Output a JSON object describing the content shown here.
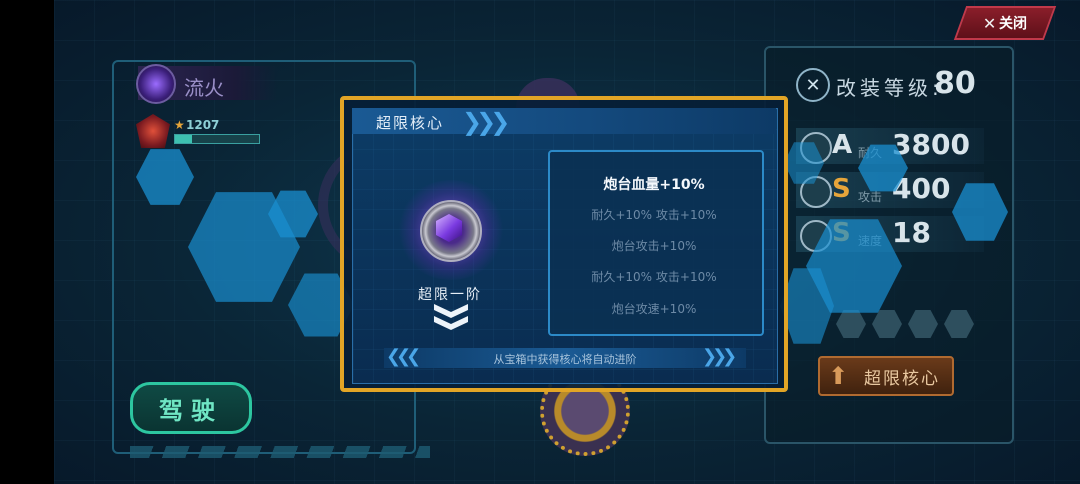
{
  "close_button": {
    "label": "关闭",
    "icon": "close-x-icon"
  },
  "pilot": {
    "name": "流火",
    "rank_value": "1207",
    "rank_progress": 0.2
  },
  "drive_button": {
    "label": "驾驶"
  },
  "modification": {
    "label": "改装等级:",
    "level": "80"
  },
  "stats": [
    {
      "grade": "A",
      "label": "耐久",
      "value": "3800",
      "grade_color": "#d8e4ea"
    },
    {
      "grade": "S",
      "label": "攻击",
      "value": "400",
      "grade_color": "#e6a53a"
    },
    {
      "grade": "S",
      "label": "速度",
      "value": "18",
      "grade_color": "#e6a53a"
    }
  ],
  "core_button": {
    "label": "超限核心"
  },
  "modal": {
    "title": "超限核心",
    "core_level": "超限一阶",
    "attributes": [
      {
        "text": "炮台血量+10%",
        "state": "current"
      },
      {
        "text": "耐久+10% 攻击+10%",
        "state": "locked"
      },
      {
        "text": "炮台攻击+10%",
        "state": "locked"
      },
      {
        "text": "耐久+10% 攻击+10%",
        "state": "locked"
      },
      {
        "text": "炮台攻速+10%",
        "state": "locked"
      }
    ],
    "footer": "从宝箱中获得核心将自动进阶"
  },
  "colors": {
    "modal_border": "#e2a526",
    "drive_button": "#2dc6a0",
    "core_button": "#b06a30",
    "close_button": "#8a1e2a"
  }
}
